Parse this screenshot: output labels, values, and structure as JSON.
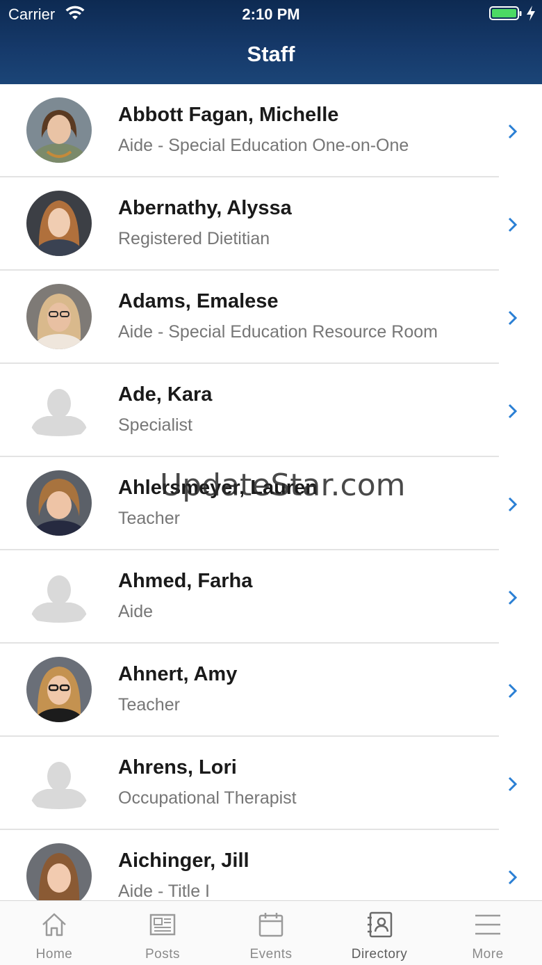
{
  "status_bar": {
    "carrier": "Carrier",
    "time": "2:10 PM"
  },
  "header": {
    "title": "Staff"
  },
  "staff": [
    {
      "name": "Abbott Fagan, Michelle",
      "role": "Aide - Special Education One-on-One"
    },
    {
      "name": "Abernathy, Alyssa",
      "role": "Registered Dietitian"
    },
    {
      "name": "Adams, Emalese",
      "role": "Aide - Special Education Resource Room"
    },
    {
      "name": "Ade, Kara",
      "role": "Specialist"
    },
    {
      "name": "Ahlersmeyer, Lauren",
      "role": "Teacher"
    },
    {
      "name": "Ahmed, Farha",
      "role": "Aide"
    },
    {
      "name": "Ahnert, Amy",
      "role": "Teacher"
    },
    {
      "name": "Ahrens, Lori",
      "role": "Occupational Therapist"
    },
    {
      "name": "Aichinger, Jill",
      "role": "Aide - Title I"
    }
  ],
  "watermark": "UpdateStar.com",
  "tabbar": {
    "home": "Home",
    "posts": "Posts",
    "events": "Events",
    "directory": "Directory",
    "more": "More"
  },
  "colors": {
    "header": "#163a6b",
    "accent": "#2a7fd4",
    "battery": "#4cd964"
  }
}
